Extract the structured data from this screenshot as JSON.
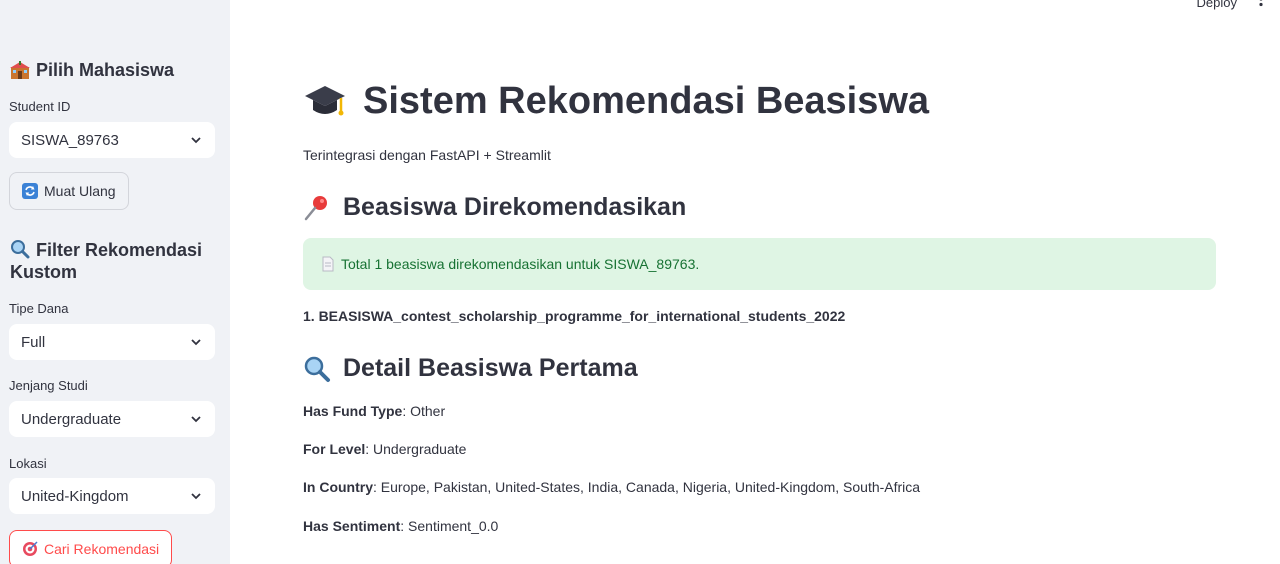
{
  "topbar": {
    "deploy_label": "Deploy"
  },
  "sidebar": {
    "select_student_header": "Pilih Mahasiswa",
    "student_id_label": "Student ID",
    "student_id_value": "SISWA_89763",
    "reload_button": "Muat Ulang",
    "filter_header": "Filter Rekomendasi Kustom",
    "fund_type_label": "Tipe Dana",
    "fund_type_value": "Full",
    "level_label": "Jenjang Studi",
    "level_value": "Undergraduate",
    "location_label": "Lokasi",
    "location_value": "United-Kingdom",
    "search_button": "Cari Rekomendasi"
  },
  "main": {
    "title": "Sistem Rekomendasi Beasiswa",
    "subtitle": "Terintegrasi dengan FastAPI + Streamlit",
    "recommended_header": "Beasiswa Direkomendasikan",
    "alert_text": "Total 1 beasiswa direkomendasikan untuk SISWA_89763.",
    "recommendation_item": "1. BEASISWA_contest_scholarship_programme_for_international_students_2022",
    "detail_header": "Detail Beasiswa Pertama",
    "details": [
      {
        "key": "Has Fund Type",
        "value": ": Other"
      },
      {
        "key": "For Level",
        "value": ": Undergraduate"
      },
      {
        "key": "In Country",
        "value": ": Europe, Pakistan, United-States, India, Canada, Nigeria, United-Kingdom, South-Africa"
      },
      {
        "key": "Has Sentiment",
        "value": ": Sentiment_0.0"
      }
    ]
  },
  "colors": {
    "sidebar_bg": "#f0f2f6",
    "accent_red": "#ff4b4b",
    "success_bg": "#dff5e4",
    "success_text": "#177233",
    "text": "#31333f"
  },
  "icons": [
    "school-building-icon",
    "reload-icon",
    "magnifier-icon",
    "chevron-down-icon",
    "graduation-cap-icon",
    "pushpin-icon",
    "document-icon",
    "target-icon",
    "kebab-menu-icon"
  ]
}
